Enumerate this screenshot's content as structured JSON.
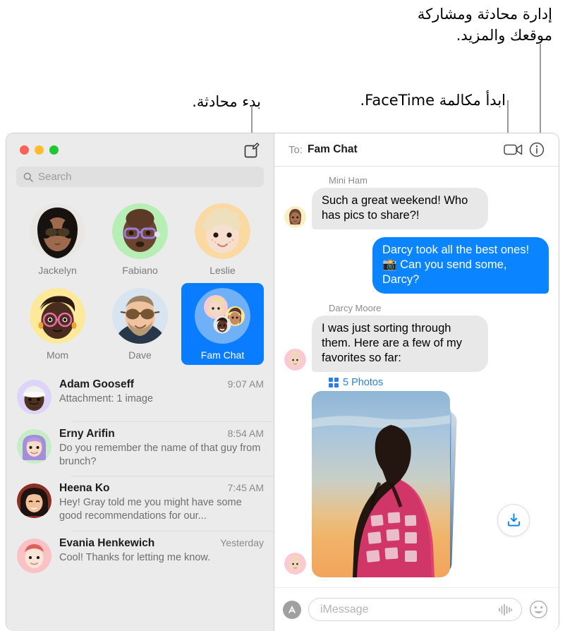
{
  "callouts": [
    {
      "id": "manage",
      "text": "إدارة محادثة ومشاركة\nموقعك والمزيد."
    },
    {
      "id": "facetime",
      "text": "ابدأ مكالمة FaceTime."
    },
    {
      "id": "newchat",
      "text": "بدء محادثة."
    }
  ],
  "window": {
    "traffic": {
      "close": "close-button",
      "minimize": "minimize-button",
      "zoom": "zoom-button"
    }
  },
  "sidebar": {
    "compose_icon": "compose-icon",
    "search": {
      "placeholder": "Search",
      "icon": "search-icon"
    },
    "pinned": [
      {
        "name": "Jackelyn",
        "selected": false
      },
      {
        "name": "Fabiano",
        "selected": false
      },
      {
        "name": "Leslie",
        "selected": false
      },
      {
        "name": "Mom",
        "selected": false
      },
      {
        "name": "Dave",
        "selected": false
      },
      {
        "name": "Fam Chat",
        "selected": true
      }
    ],
    "conversations": [
      {
        "name": "Adam Gooseff",
        "time": "9:07 AM",
        "preview": "Attachment: 1 image"
      },
      {
        "name": "Erny Arifin",
        "time": "8:54 AM",
        "preview": "Do you remember the name of that guy from brunch?"
      },
      {
        "name": "Heena Ko",
        "time": "7:45 AM",
        "preview": "Hey! Gray told me you might have some good recommendations for our..."
      },
      {
        "name": "Evania Henkewich",
        "time": "Yesterday",
        "preview": "Cool! Thanks for letting me know."
      }
    ]
  },
  "chat": {
    "to_label": "To:",
    "to_value": "Fam Chat",
    "facetime_icon": "video-camera-icon",
    "info_icon": "info-circle-icon",
    "messages": [
      {
        "sender": "Mini Ham",
        "direction": "in",
        "text": "Such a great weekend! Who has pics to share?!"
      },
      {
        "sender": "",
        "direction": "out",
        "text": "Darcy took all the best ones! 📸 Can you send some, Darcy?"
      },
      {
        "sender": "Darcy Moore",
        "direction": "in",
        "text": "I was just sorting through them. Here are a few of my favorites so far:"
      }
    ],
    "attachment": {
      "count_label": "5 Photos",
      "grid_icon": "photo-grid-icon",
      "download_icon": "download-icon"
    },
    "composer": {
      "apps_icon": "app-store-icon",
      "placeholder": "iMessage",
      "audio_icon": "audio-waveform-icon",
      "emoji_icon": "emoji-smiley-icon"
    }
  },
  "colors": {
    "accent_blue": "#0a84ff",
    "selection_blue": "#0a7cff",
    "incoming_bubble": "#e8e8e8",
    "sidebar_bg": "#ebebeb",
    "link_blue": "#2a7fe0"
  }
}
